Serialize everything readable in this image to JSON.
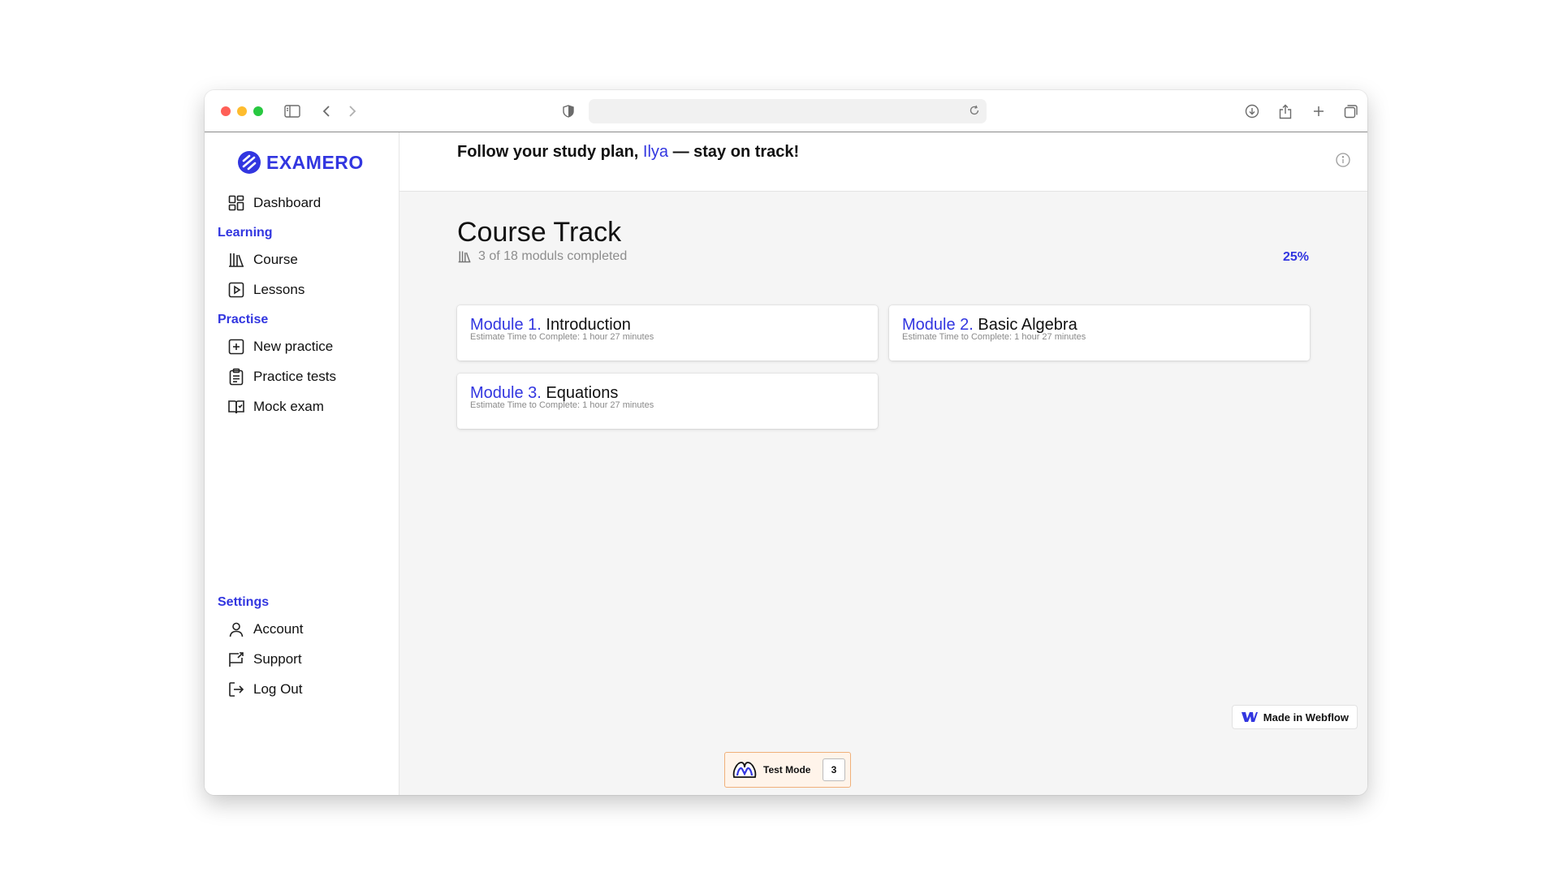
{
  "colors": {
    "accent": "#3236e0",
    "testmode_bg": "#fff4ea",
    "testmode_border": "#f0b07a"
  },
  "sidebar": {
    "logo_text": "EXAMERO",
    "dashboard": {
      "label": "Dashboard",
      "icon": "dashboard-grid-icon"
    },
    "sections": {
      "learning": "Learning",
      "practise": "Practise",
      "settings": "Settings"
    },
    "learning_items": [
      {
        "label": "Course",
        "icon": "books-icon"
      },
      {
        "label": "Lessons",
        "icon": "play-square-icon"
      }
    ],
    "practise_items": [
      {
        "label": "New practice",
        "icon": "plus-square-icon"
      },
      {
        "label": "Practice tests",
        "icon": "clipboard-icon"
      },
      {
        "label": "Mock exam",
        "icon": "open-book-icon"
      }
    ],
    "settings_items": [
      {
        "label": "Account",
        "icon": "user-icon"
      },
      {
        "label": "Support",
        "icon": "support-flag-icon"
      },
      {
        "label": "Log Out",
        "icon": "logout-icon"
      }
    ]
  },
  "header": {
    "greeting_prefix": "Follow your study plan, ",
    "user_name": "Ilya",
    "greeting_suffix": " — stay on track!"
  },
  "main": {
    "title": "Course Track",
    "progress_text": "3 of 18 moduls completed",
    "progress_percent_label": "25%",
    "progress_fraction": 0.25,
    "modules": [
      {
        "number": "Module 1.",
        "name": "Introduction",
        "estimate": "Estimate Time to Complete: 1 hour 27 minutes"
      },
      {
        "number": "Module 2.",
        "name": "Basic Algebra",
        "estimate": "Estimate Time to Complete: 1 hour 27 minutes"
      },
      {
        "number": "Module 3.",
        "name": "Equations",
        "estimate": "Estimate Time to Complete: 1 hour 27 minutes"
      }
    ]
  },
  "test_mode": {
    "label": "Test Mode",
    "count": "3"
  },
  "webflow_badge": {
    "label": "Made in Webflow"
  }
}
